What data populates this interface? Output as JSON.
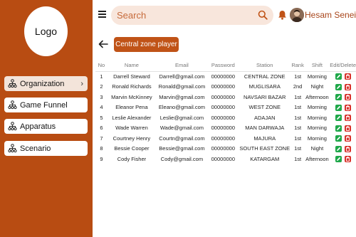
{
  "sidebar": {
    "logo_text": "Logo",
    "items": [
      {
        "label": "Organization",
        "active": true
      },
      {
        "label": "Game Funnel",
        "active": false
      },
      {
        "label": "Apparatus",
        "active": false
      },
      {
        "label": "Scenario",
        "active": false
      }
    ],
    "background": "#b84c12"
  },
  "header": {
    "search_placeholder": "Search",
    "user_name": "Hesam Senei"
  },
  "main": {
    "zone_button": "Central zone player",
    "table": {
      "columns": [
        "No",
        "Name",
        "Email",
        "Password",
        "Station",
        "Rank",
        "Shift",
        "Edit/Delete"
      ],
      "rows": [
        {
          "no": "1",
          "name": "Darrell Steward",
          "email": "Darrell@gmail.com",
          "password": "00000000",
          "station": "CENTRAL ZONE",
          "rank": "1st",
          "shift": "Morning"
        },
        {
          "no": "2",
          "name": "Ronald Richards",
          "email": "Ronald@gmail.com",
          "password": "00000000",
          "station": "MUGLISARA",
          "rank": "2nd",
          "shift": "Night"
        },
        {
          "no": "3",
          "name": "Marvin McKinney",
          "email": "Marvin@gmail.com",
          "password": "00000000",
          "station": "NAVSARI BAZAR",
          "rank": "1st",
          "shift": "Afternoon"
        },
        {
          "no": "4",
          "name": "Eleanor Pena",
          "email": "Eleano@gmail.com",
          "password": "00000000",
          "station": "WEST ZONE",
          "rank": "1st",
          "shift": "Morning"
        },
        {
          "no": "5",
          "name": "Leslie Alexander",
          "email": "Leslie@gmail.com",
          "password": "00000000",
          "station": "ADAJAN",
          "rank": "1st",
          "shift": "Morning"
        },
        {
          "no": "6",
          "name": "Wade Warren",
          "email": "Wade@gmail.com",
          "password": "00000000",
          "station": "MAN DARWAJA",
          "rank": "1st",
          "shift": "Morning"
        },
        {
          "no": "7",
          "name": "Courtney Henry",
          "email": "Courtn@gmail.com",
          "password": "00000000",
          "station": "MAJURA",
          "rank": "1st",
          "shift": "Morning"
        },
        {
          "no": "8",
          "name": "Bessie Cooper",
          "email": "Bessie@gmail.com",
          "password": "00000000",
          "station": "SOUTH EAST ZONE",
          "rank": "1st",
          "shift": "Night"
        },
        {
          "no": "9",
          "name": "Cody Fisher",
          "email": "Cody@gmail.com",
          "password": "00000000",
          "station": "KATARGAM",
          "rank": "1st",
          "shift": "Afternoon"
        }
      ]
    }
  },
  "colors": {
    "accent": "#c05317",
    "edit": "#1fa84a",
    "delete": "#d8312b",
    "search_bg": "#f8e6dc"
  }
}
